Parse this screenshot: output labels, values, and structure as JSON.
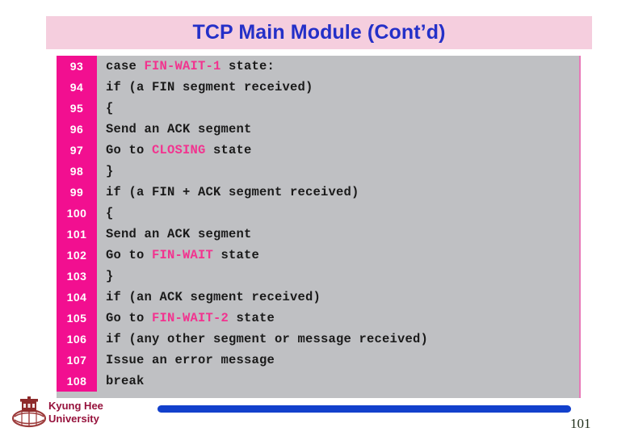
{
  "slide": {
    "title": "TCP Main Module (Cont’d)",
    "page_number": "101",
    "title_color": "#2430c8",
    "title_bar_color": "#f5cede",
    "code_bg_color": "#bfc0c3",
    "gutter_color": "#f20f90",
    "keyword_color": "#f2338f",
    "accent_bar_color": "#1240cc"
  },
  "footer": {
    "logo_icon": "kyung-hee-crest-icon",
    "university_line1": "Kyung Hee",
    "university_line2": "University",
    "university_name": "Kyung Hee\nUniversity",
    "university_color": "#96123c"
  },
  "code": {
    "lines": [
      {
        "number": "93",
        "indent": 0,
        "segments": [
          {
            "text": "case ",
            "kw": false
          },
          {
            "text": "FIN-WAIT-1",
            "kw": true
          },
          {
            "text": " state:",
            "kw": false
          }
        ]
      },
      {
        "number": "94",
        "indent": 2,
        "segments": [
          {
            "text": "if (a FIN segment received)",
            "kw": false
          }
        ]
      },
      {
        "number": "95",
        "indent": 2,
        "segments": [
          {
            "text": "{",
            "kw": false
          }
        ]
      },
      {
        "number": "96",
        "indent": 5,
        "segments": [
          {
            "text": "Send an ACK segment",
            "kw": false
          }
        ]
      },
      {
        "number": "97",
        "indent": 5,
        "segments": [
          {
            "text": "Go to ",
            "kw": false
          },
          {
            "text": "CLOSING",
            "kw": true
          },
          {
            "text": " state",
            "kw": false
          }
        ]
      },
      {
        "number": "98",
        "indent": 2,
        "segments": [
          {
            "text": "}",
            "kw": false
          }
        ]
      },
      {
        "number": "99",
        "indent": 2,
        "segments": [
          {
            "text": "if (a FIN + ACK segment received)",
            "kw": false
          }
        ]
      },
      {
        "number": "100",
        "indent": 2,
        "segments": [
          {
            "text": "{",
            "kw": false
          }
        ]
      },
      {
        "number": "101",
        "indent": 5,
        "segments": [
          {
            "text": "Send an ACK segment",
            "kw": false
          }
        ]
      },
      {
        "number": "102",
        "indent": 5,
        "segments": [
          {
            "text": "Go to ",
            "kw": false
          },
          {
            "text": "FIN-WAIT",
            "kw": true
          },
          {
            "text": " state",
            "kw": false
          }
        ]
      },
      {
        "number": "103",
        "indent": 2,
        "segments": [
          {
            "text": "}",
            "kw": false
          }
        ]
      },
      {
        "number": "104",
        "indent": 2,
        "segments": [
          {
            "text": "if (an ACK segment received)",
            "kw": false
          }
        ]
      },
      {
        "number": "105",
        "indent": 4,
        "segments": [
          {
            "text": "Go to ",
            "kw": false
          },
          {
            "text": "FIN-WAIT-2",
            "kw": true
          },
          {
            "text": " state",
            "kw": false
          }
        ]
      },
      {
        "number": "106",
        "indent": 2,
        "segments": [
          {
            "text": "if (any other segment or message received)",
            "kw": false
          }
        ]
      },
      {
        "number": "107",
        "indent": 4,
        "segments": [
          {
            "text": "Issue an error message",
            "kw": false
          }
        ]
      },
      {
        "number": "108",
        "indent": 2,
        "segments": [
          {
            "text": "break",
            "kw": false
          }
        ]
      }
    ]
  }
}
